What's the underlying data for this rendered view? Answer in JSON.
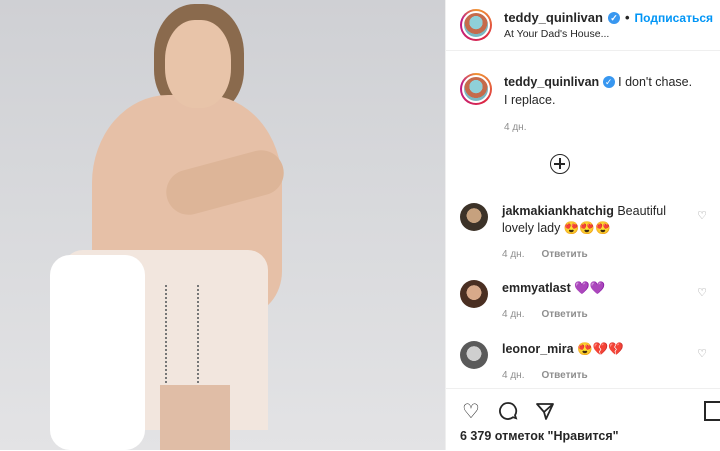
{
  "header": {
    "username": "teddy_quinlivan",
    "separator": "•",
    "follow_label": "Подписаться",
    "location": "At Your Dad's House..."
  },
  "caption": {
    "username": "teddy_quinlivan",
    "text": "I don't chase. I replace.",
    "time": "4 дн."
  },
  "comments": [
    {
      "username": "jakmakiankhatchig",
      "text": "Beautiful lovely lady 😍😍😍",
      "time": "4 дн.",
      "reply": "Ответить"
    },
    {
      "username": "emmyatlast",
      "text": "💜💜",
      "time": "4 дн.",
      "reply": "Ответить"
    },
    {
      "username": "leonor_mira",
      "text": "😍💔💔",
      "time": "4 дн.",
      "reply": "Ответить"
    }
  ],
  "footer": {
    "likes": "6 379 отметок \"Нравится\""
  },
  "icons": {
    "verified": "verified-icon",
    "like": "heart-icon",
    "comment": "comment-icon",
    "share": "share-icon",
    "save": "bookmark-icon",
    "load_more": "plus-circle-icon"
  },
  "colors": {
    "link": "#0095f6",
    "verified": "#3897f0",
    "muted": "#8e8e8e"
  }
}
